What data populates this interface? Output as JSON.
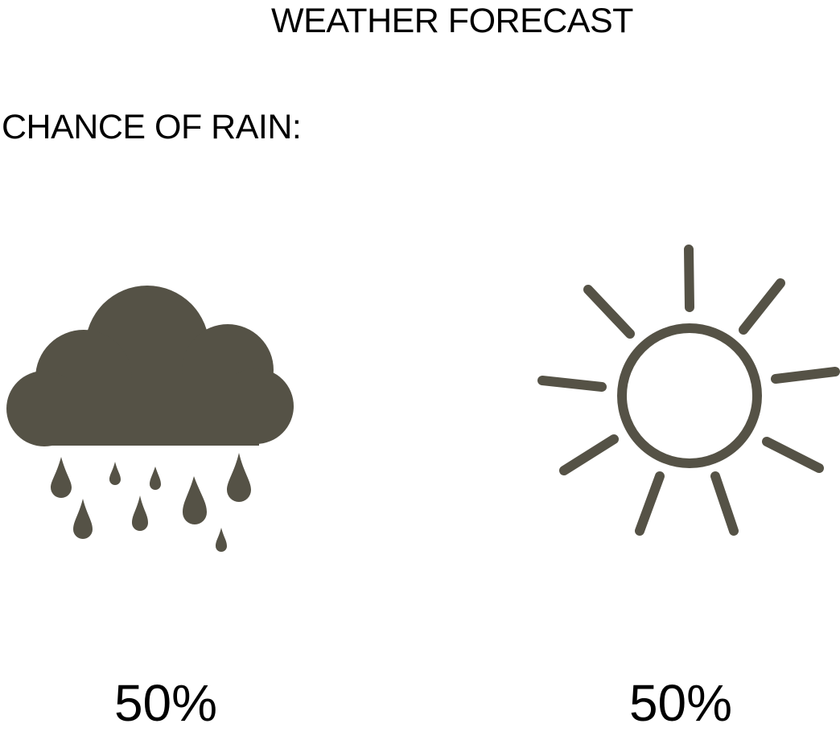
{
  "header": {
    "title": "WEATHER FORECAST",
    "subtitle": "CHANCE OF RAIN:"
  },
  "forecasts": [
    {
      "icon": "rain-cloud-icon",
      "percent": "50%"
    },
    {
      "icon": "sun-icon",
      "percent": "50%"
    }
  ],
  "colors": {
    "icon": "#555246",
    "text": "#000000",
    "background": "#ffffff"
  }
}
